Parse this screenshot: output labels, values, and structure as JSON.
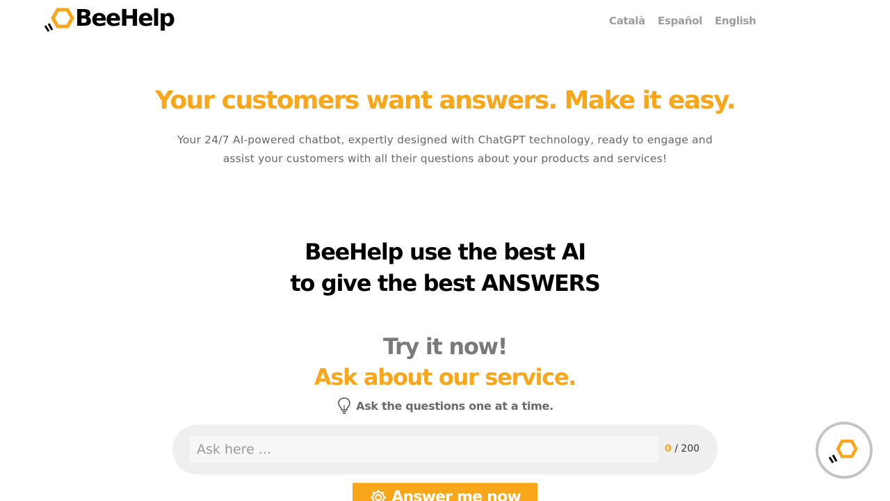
{
  "header": {
    "brand": "BeeHelp",
    "languages": [
      "Català",
      "Español",
      "English"
    ]
  },
  "hero": {
    "title": "Your customers want answers. Make it easy.",
    "subtitle": "Your 24/7 AI-powered chatbot, expertly designed with ChatGPT technology, ready to engage and assist your customers with all their questions about your products and services!"
  },
  "ai_section": {
    "line1": "BeeHelp use the best AI",
    "line2": "to give the best ANSWERS"
  },
  "try_section": {
    "title": "Try it now!",
    "subtitle": "Ask about our service.",
    "hint": "Ask the questions one at a time.",
    "hint_icon": "lightbulb-icon",
    "input_value": "",
    "input_placeholder": "Ask here ...",
    "counter_current": "0",
    "counter_separator": "/ 200",
    "button_label": "Answer me now",
    "button_icon": "gear-icon"
  },
  "chat_launcher": {
    "icon": "beehelp-hexagon-icon"
  },
  "colors": {
    "accent": "#f9a61b",
    "heading_dark": "#000000",
    "heading_gray": "#7a7a7a",
    "text": "#666666",
    "nav": "#9c9c9c",
    "input_bg": "#efefef",
    "launcher_border": "#c4c4c4"
  }
}
